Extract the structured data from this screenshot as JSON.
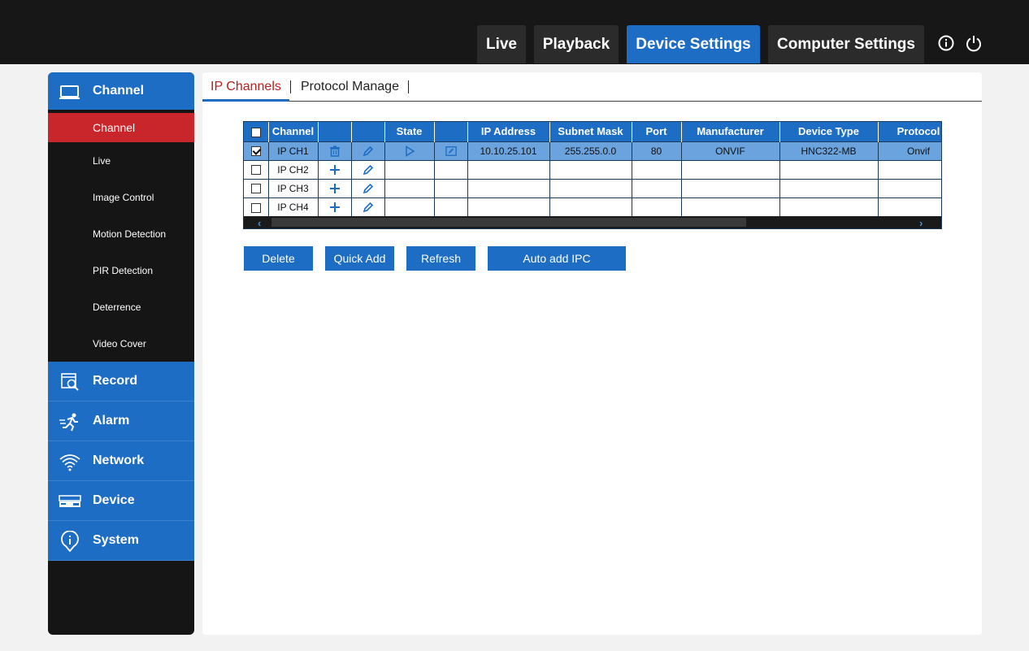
{
  "topnav": {
    "items": [
      {
        "label": "Live",
        "active": false
      },
      {
        "label": "Playback",
        "active": false
      },
      {
        "label": "Device Settings",
        "active": true
      },
      {
        "label": "Computer Settings",
        "active": false
      }
    ],
    "icons": [
      "info-icon",
      "power-icon"
    ]
  },
  "sidebar": {
    "channel": {
      "label": "Channel",
      "icon": "monitor-icon"
    },
    "sub_items": [
      "Channel",
      "Live",
      "Image Control",
      "Motion Detection",
      "PIR Detection",
      "Deterrence",
      "Video Cover"
    ],
    "active_sub": "Channel",
    "sections": [
      {
        "label": "Record",
        "icon": "record-search-icon"
      },
      {
        "label": "Alarm",
        "icon": "running-person-icon"
      },
      {
        "label": "Network",
        "icon": "wifi-icon"
      },
      {
        "label": "Device",
        "icon": "dvr-device-icon"
      },
      {
        "label": "System",
        "icon": "info-pin-icon"
      }
    ]
  },
  "tabs": {
    "ip_channels": "IP Channels",
    "protocol_manage": "Protocol Manage"
  },
  "table": {
    "headers": [
      "",
      "Channel",
      "",
      "",
      "State",
      "",
      "IP Address",
      "Subnet Mask",
      "Port",
      "Manufacturer",
      "Device Type",
      "Protocol"
    ],
    "rows": [
      {
        "checked": true,
        "channel": "IP CH1",
        "action": "delete",
        "state": "play",
        "ip": "10.10.25.101",
        "mask": "255.255.0.0",
        "port": "80",
        "manufacturer": "ONVIF",
        "device_type": "HNC322-MB",
        "protocol": "Onvif"
      },
      {
        "checked": false,
        "channel": "IP CH2",
        "action": "add",
        "state": "",
        "ip": "",
        "mask": "",
        "port": "",
        "manufacturer": "",
        "device_type": "",
        "protocol": ""
      },
      {
        "checked": false,
        "channel": "IP CH3",
        "action": "add",
        "state": "",
        "ip": "",
        "mask": "",
        "port": "",
        "manufacturer": "",
        "device_type": "",
        "protocol": ""
      },
      {
        "checked": false,
        "channel": "IP CH4",
        "action": "add",
        "state": "",
        "ip": "",
        "mask": "",
        "port": "",
        "manufacturer": "",
        "device_type": "",
        "protocol": ""
      }
    ]
  },
  "buttons": {
    "delete": "Delete",
    "quick_add": "Quick Add",
    "refresh": "Refresh",
    "auto_add": "Auto add IPC"
  },
  "colors": {
    "accent": "#1e6dc4",
    "active_sub": "#c8262b",
    "selected_row": "#6aa3de",
    "topbar": "#171717"
  }
}
